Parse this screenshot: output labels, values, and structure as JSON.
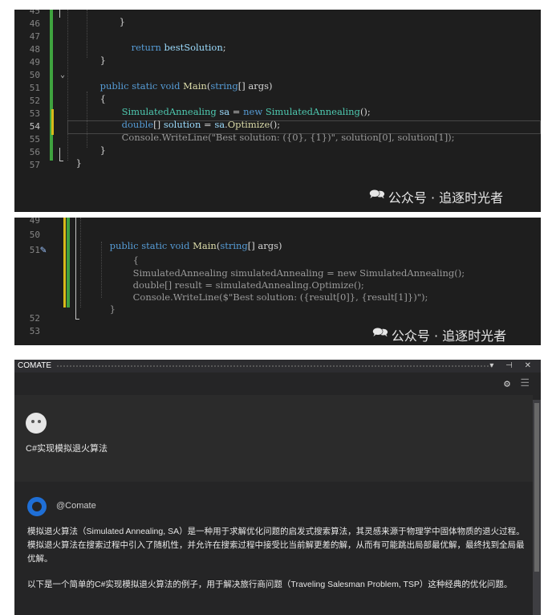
{
  "watermark": "公众号 · 追逐时光者",
  "panel1": {
    "line_numbers": [
      "45",
      "46",
      "47",
      "48",
      "49",
      "50",
      "51",
      "52",
      "53",
      "54",
      "55",
      "56",
      "57"
    ],
    "current_line": "54",
    "code": {
      "l45": "}",
      "l47_kw": "return",
      "l47_id": "bestSolution",
      "l47_end": ";",
      "l48": "}",
      "l50_kw": "public static void",
      "l50_fn": "Main",
      "l50_par_open": "(",
      "l50_ty": "string",
      "l50_rest": "[] args)",
      "l51": "{",
      "l52_ty": "SimulatedAnnealing",
      "l52_id": "sa",
      "l52_eq": " = ",
      "l52_kw": "new",
      "l52_ty2": "SimulatedAnnealing",
      "l52_end": "();",
      "l53_kw": "double",
      "l53_br": "[] ",
      "l53_id": "solution",
      "l53_eq": " = ",
      "l53_id2": "sa",
      "l53_dot": ".",
      "l53_fn": "Optimize",
      "l53_end": "();",
      "l54": "Console.WriteLine(\"Best solution: ({0}, {1})\", solution[0], solution[1]);",
      "l55": "}",
      "l56": "}"
    }
  },
  "panel2": {
    "line_numbers": [
      "49",
      "50",
      "51",
      "52",
      "53"
    ],
    "code": {
      "l50_kw": "public static void",
      "l50_fn": "Main",
      "l50_par_open": "(",
      "l50_ty": "string",
      "l50_rest": "[] args)",
      "g1": "{",
      "g2": "SimulatedAnnealing simulatedAnnealing = new SimulatedAnnealing();",
      "g3": "double[] result = simulatedAnnealing.Optimize();",
      "g4": "Console.WriteLine($\"Best solution: ({result[0]}, {result[1]})\");",
      "g5": "}"
    }
  },
  "comate": {
    "title": "COMATE",
    "title_controls": "▾ ⊣ ✕",
    "user_question": "C#实现模拟退火算法",
    "bot_handle": "@Comate",
    "paragraph1": "模拟退火算法（Simulated Annealing, SA）是一种用于求解优化问题的启发式搜索算法，其灵感来源于物理学中固体物质的退火过程。模拟退火算法在搜索过程中引入了随机性，并允许在搜索过程中接受比当前解更差的解，从而有可能跳出局部最优解，最终找到全局最优解。",
    "paragraph2": "以下是一个简单的C#实现模拟退火算法的例子，用于解决旅行商问题（Traveling Salesman Problem, TSP）这种经典的优化问题。",
    "icons": [
      "gear-icon",
      "menu-icon"
    ]
  }
}
